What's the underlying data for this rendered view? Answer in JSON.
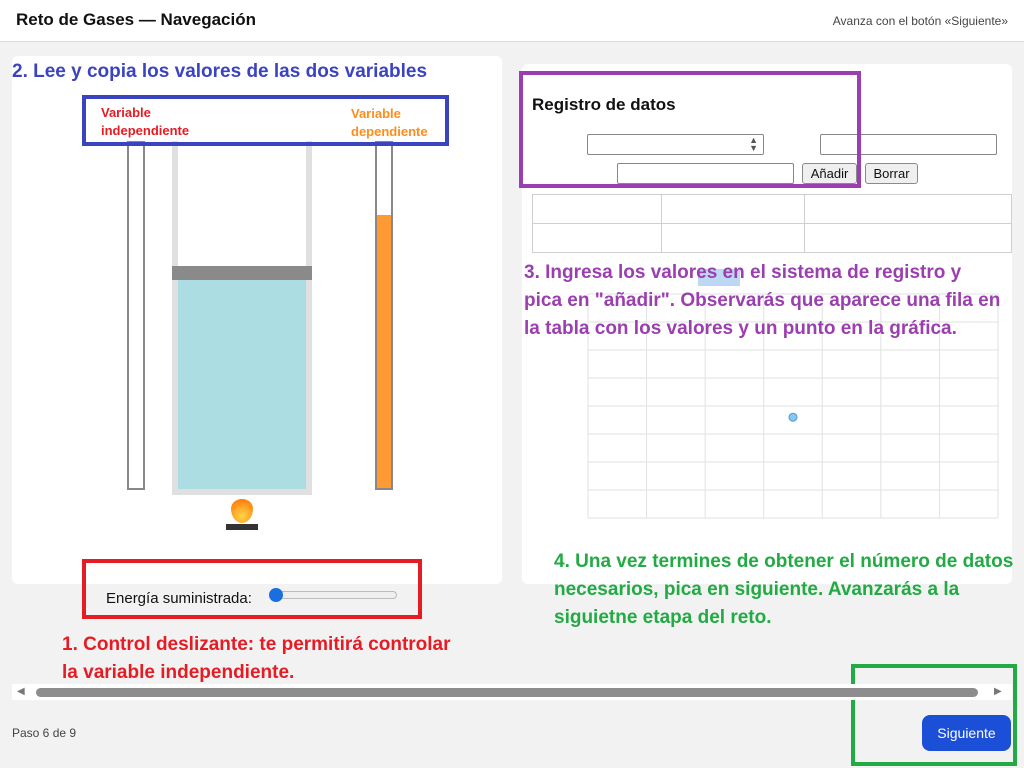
{
  "header": {
    "title": "Reto de Gases — Navegación",
    "hint": "Avanza con el botón «Siguiente»"
  },
  "annotations": {
    "step2": "2. Lee y copia los valores de las dos variables",
    "step3": "3. Ingresa los valores en el sistema de registro y pica en \"añadir\". Observarás que aparece una fila en la tabla con los valores y un punto en la gráfica.",
    "step4": "4. Una vez termines de obtener el número de datos necesarios, pica en siguiente. Avanzarás a la siguietne etapa del reto.",
    "step1": "1. Control deslizante: te permitirá controlar la variable independiente."
  },
  "simulation": {
    "independent_label": "Variable independiente",
    "dependent_label": "Variable dependiente",
    "dependent_level": 0.79,
    "energy_label": "Energía suministrada:",
    "energy_value": 0
  },
  "registro": {
    "title": "Registro de datos",
    "select_value": "",
    "input_a": "",
    "input_b": "",
    "add_label": "Añadir",
    "clear_label": "Borrar",
    "table_rows": [
      [
        "",
        "",
        ""
      ],
      [
        "",
        "",
        ""
      ]
    ]
  },
  "chart_data": {
    "type": "scatter",
    "points": [
      {
        "x": 0.5,
        "y": 0.55
      }
    ],
    "grid": true,
    "point_color": "#88c8f0"
  },
  "footer": {
    "step_text": "Paso 6 de 9",
    "next_label": "Siguiente"
  },
  "colors": {
    "blue": "#3b44c0",
    "purple": "#9b3fb0",
    "red": "#e51c24",
    "green": "#22aa44",
    "next_button": "#1c4fd8"
  }
}
